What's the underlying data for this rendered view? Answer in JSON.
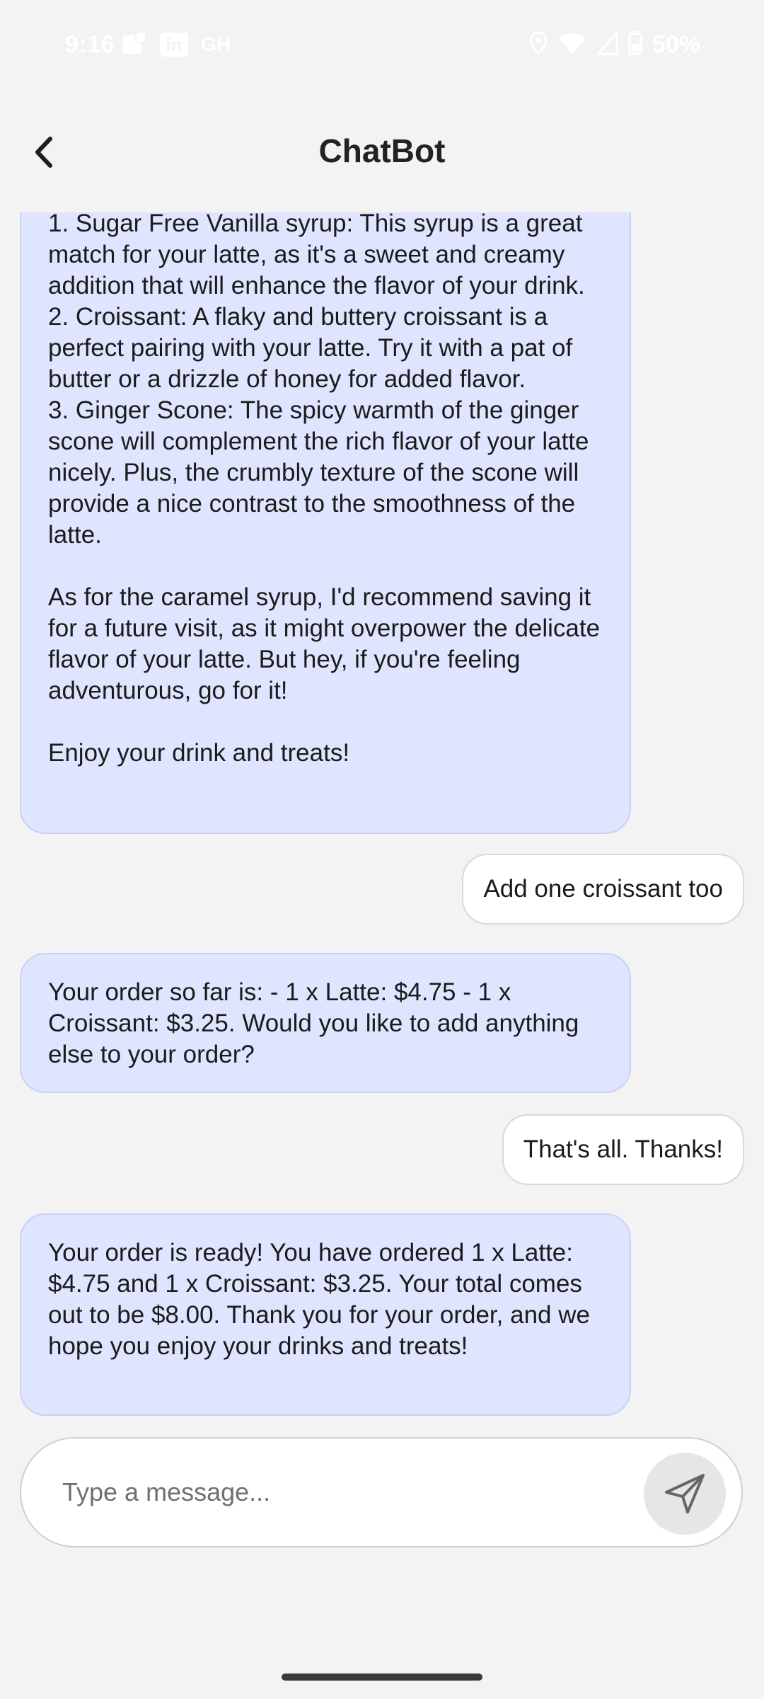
{
  "status_bar": {
    "time": "9:16",
    "app_icons": [
      "notification-icon",
      "linkedin-icon",
      "github-icon"
    ],
    "app_labels": {
      "linkedin": "in",
      "github": "GH"
    },
    "battery": "50%"
  },
  "header": {
    "title": "ChatBot"
  },
  "messages": [
    {
      "sender": "bot",
      "text": "1. Sugar Free Vanilla syrup: This syrup is a great match for your latte, as it's a sweet and creamy addition that will enhance the flavor of your drink.\n2. Croissant: A flaky and buttery croissant is a perfect pairing with your latte. Try it with a pat of butter or a drizzle of honey for added flavor.\n3. Ginger Scone: The spicy warmth of the ginger scone will complement the rich flavor of your latte nicely. Plus, the crumbly texture of the scone will provide a nice contrast to the smoothness of the latte.\n\nAs for the caramel syrup, I'd recommend saving it for a future visit, as it might overpower the delicate flavor of your latte. But hey, if you're feeling adventurous, go for it!\n\nEnjoy your drink and treats!"
    },
    {
      "sender": "user",
      "text": "Add one croissant too"
    },
    {
      "sender": "bot",
      "text": "Your order so far is: - 1 x Latte: $4.75 - 1 x Croissant: $3.25. Would you like to add anything else to your order?"
    },
    {
      "sender": "user",
      "text": "That's all. Thanks!"
    },
    {
      "sender": "bot",
      "text": "Your order is ready! You have ordered 1 x Latte: $4.75 and 1 x Croissant: $3.25. Your total comes out to be $8.00. Thank you for your order, and we hope you enjoy your drinks and treats!"
    }
  ],
  "composer": {
    "placeholder": "Type a message..."
  },
  "colors": {
    "bot_bubble": "#e0e5ff",
    "user_bubble": "#ffffff",
    "background": "#f3f3f3"
  }
}
